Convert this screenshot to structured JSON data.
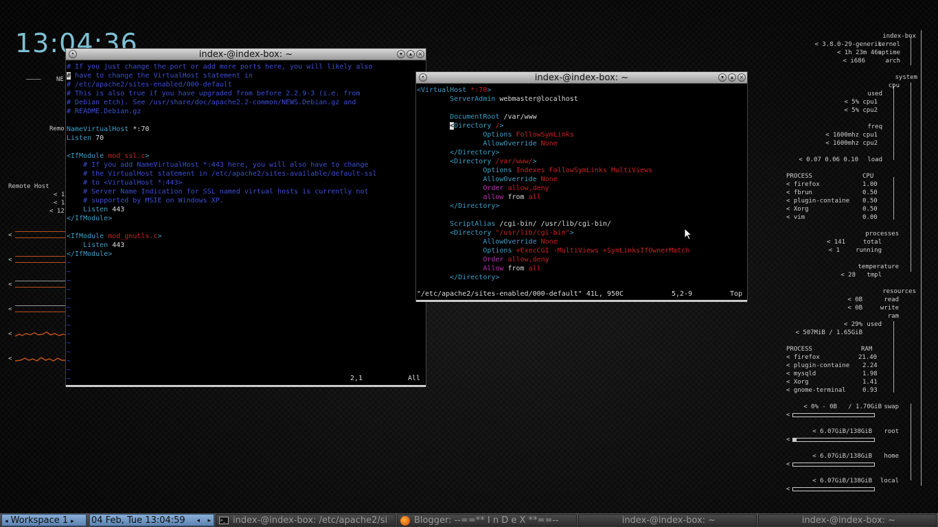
{
  "clock": "13:04:36",
  "left_conky": {
    "net_label": "NE",
    "remote_short": "Remo",
    "remote_host": "Remote Host",
    "marks": [
      "<",
      "<",
      "<",
      "<",
      "<",
      "<"
    ],
    "small": [
      "< 1!",
      "< 1!",
      "< 12("
    ]
  },
  "win1": {
    "title": "index-@index-box: ~",
    "status_pos": "2,1",
    "status_pct": "All"
  },
  "win2": {
    "title": "index-@index-box: ~",
    "status_file": "\"/etc/apache2/sites-enabled/000-default\" 41L, 950C",
    "status_pos": "5,2-9",
    "status_pct": "Top"
  },
  "right": {
    "hostname": "index-box",
    "kernel": "< 3.8.0-29-generic",
    "kernel_l": "kernel",
    "uptime": "< 1h 23m 46s",
    "uptime_l": "uptime",
    "arch": "< i686",
    "arch_l": "arch",
    "system": "system",
    "cpu": "cpu",
    "used": "used",
    "cpu1": "< 5%",
    "cpu1_l": "cpu1",
    "cpu2": "< 5%",
    "cpu2_l": "cpu2",
    "freq": "freq",
    "f1": "< 1600mhz",
    "f1_l": "cpu1",
    "f2": "< 1600mhz",
    "f2_l": "cpu2",
    "load_v": "< 0.07 0.06 0.10",
    "load_l": "load",
    "proc_h": "PROCESS",
    "cpu_h": "CPU",
    "cpu_procs": [
      {
        "name": "< firefox",
        "val": "1.00"
      },
      {
        "name": "< fbrun",
        "val": "0.50"
      },
      {
        "name": "< plugin-containe",
        "val": "0.50"
      },
      {
        "name": "< Xorg",
        "val": "0.50"
      },
      {
        "name": "< vim",
        "val": "0.00"
      }
    ],
    "processes": "processes",
    "total_v": "< 141",
    "total_l": "total",
    "running_v": "< 1",
    "running_l": "running",
    "temperature": "temperature",
    "temp_v": "< 28",
    "temp_l": "tmpl",
    "resources": "resources",
    "read_v": "< 0B",
    "read_l": "read",
    "write_v": "< 0B",
    "write_l": "write",
    "ram": "ram",
    "ram_used_v": "< 29%",
    "ram_used_l": "used",
    "ram_amount": "< 507MiB / 1.65GiB",
    "ram_h": "RAM",
    "ram_procs": [
      {
        "name": "< firefox",
        "val": "21.40"
      },
      {
        "name": "< plugin-containe",
        "val": "2.24"
      },
      {
        "name": "< mysqld",
        "val": "1.98"
      },
      {
        "name": "< Xorg",
        "val": "1.41"
      },
      {
        "name": "< gnome-terminal",
        "val": "0.93"
      }
    ],
    "swap_v": "< 0% - 0B   / 1.70GiB",
    "swap_l": "swap",
    "swap_pct": 0,
    "root_v": "< 6.07GiB/138GiB",
    "root_l": "root",
    "root_pct": 4.4,
    "home_v": "< 6.07GiB/138GiB",
    "home_l": "home",
    "home_pct": 0,
    "local_v": "< 6.07GiB/138GiB",
    "local_l": "local",
    "local_pct": 0
  },
  "taskbar": {
    "workspace": "Workspace 1",
    "datetime": "04 Feb, Tue 13:04:59",
    "tasks": [
      "index-@index-box: /etc/apache2/si",
      "Blogger: --==** I n D e X **==--",
      "index-@index-box: ~",
      "index-@index-box: ~"
    ]
  },
  "colors": {
    "clock": "#7ec1d4",
    "comment": "#3d4fd6",
    "keyword": "#3fa0c7",
    "value": "#cc2222",
    "magenta": "#bb33bb"
  }
}
